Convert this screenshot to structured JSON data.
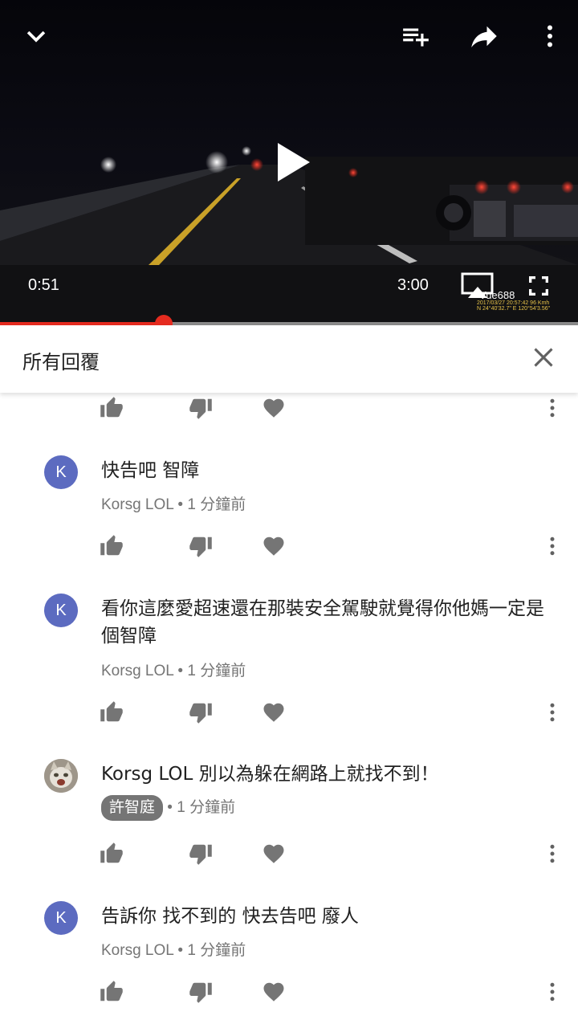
{
  "player": {
    "current_time": "0:51",
    "duration": "3:00",
    "progress_fraction": 0.283,
    "watermark": "Vue688",
    "overlay_line1": "2017/03/27 20:57:42  96 Kmh",
    "overlay_line2": "N 24°40'32.7\"  E 120°54'3.56\"",
    "accent_color": "#e52b1f"
  },
  "header": {
    "title": "所有回覆"
  },
  "comments": [
    {
      "avatar": "K",
      "text": "快告吧 智障",
      "author": "Korsg LOL",
      "separator": "•",
      "time": "1 分鐘前"
    },
    {
      "avatar": "K",
      "text": "看你這麼愛超速還在那裝安全駕駛就覺得你他媽一定是個智障",
      "author": "Korsg LOL",
      "separator": "•",
      "time": "1 分鐘前"
    },
    {
      "avatar": "cat-photo",
      "text": "Korsg LOL 別以為躲在網路上就找不到！",
      "author": "許智庭",
      "separator": "•",
      "time": "1 分鐘前"
    },
    {
      "avatar": "K",
      "text": "告訴你 找不到的 快去告吧 廢人",
      "author": "Korsg LOL",
      "separator": "•",
      "time": "1 分鐘前"
    }
  ],
  "icons": {
    "collapse": "chevron-down-icon",
    "add_to_playlist": "playlist-add-icon",
    "share": "share-icon",
    "more": "more-vert-icon",
    "play": "play-icon",
    "cast": "cast-icon",
    "fullscreen": "fullscreen-icon",
    "close": "close-icon",
    "like": "thumb-up-icon",
    "dislike": "thumb-down-icon",
    "heart": "heart-icon"
  }
}
